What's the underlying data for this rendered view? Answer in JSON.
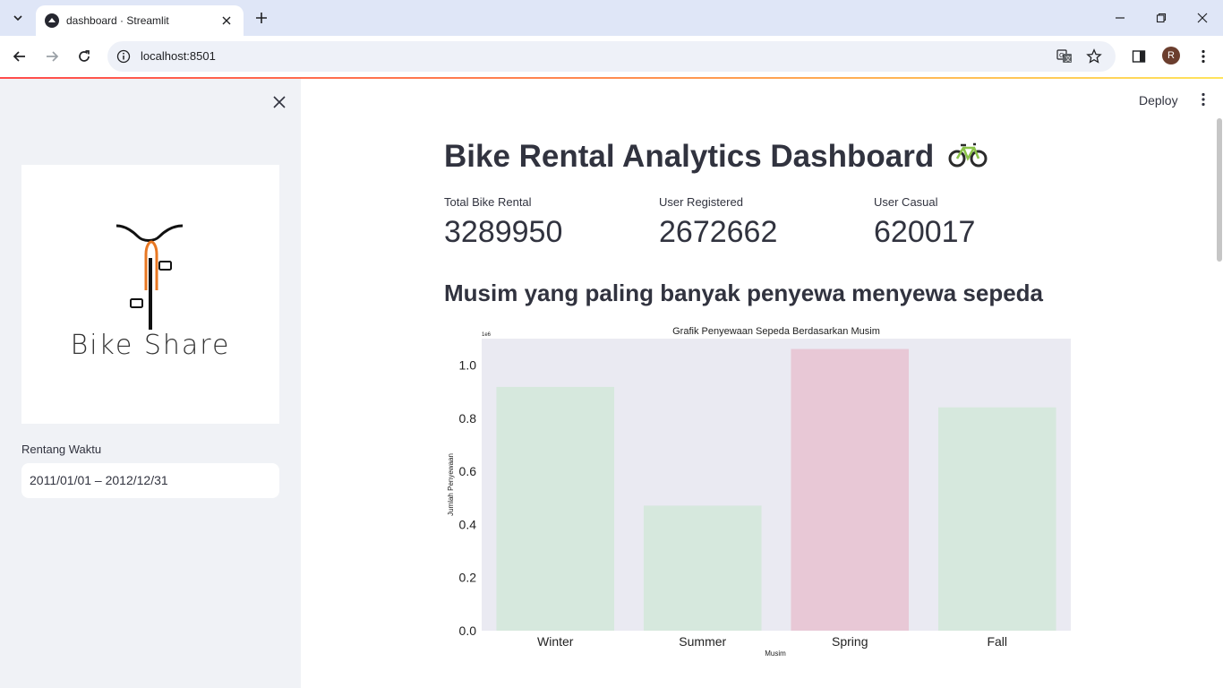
{
  "browser": {
    "tab_title": "dashboard · Streamlit",
    "url": "localhost:8501",
    "avatar_initial": "R"
  },
  "sidebar": {
    "logo_text": "Bike Share",
    "date_label": "Rentang Waktu",
    "date_value": "2011/01/01 – 2012/12/31"
  },
  "header": {
    "deploy_label": "Deploy"
  },
  "main": {
    "title": "Bike Rental Analytics Dashboard",
    "metrics": [
      {
        "label": "Total Bike Rental",
        "value": "3289950"
      },
      {
        "label": "User Registered",
        "value": "2672662"
      },
      {
        "label": "User Casual",
        "value": "620017"
      }
    ],
    "section_title": "Musim yang paling banyak penyewa menyewa sepeda"
  },
  "chart_data": {
    "type": "bar",
    "title": "Grafik Penyewaan Sepeda Berdasarkan Musim",
    "xlabel": "Musim",
    "ylabel": "Jumlah Penyewaan",
    "scale_label": "1e6",
    "categories": [
      "Winter",
      "Summer",
      "Spring",
      "Fall"
    ],
    "values": [
      0.918,
      0.471,
      1.061,
      0.841
    ],
    "ylim": [
      0,
      1.1
    ],
    "yticks": [
      "0.0",
      "0.2",
      "0.4",
      "0.6",
      "0.8",
      "1.0"
    ],
    "colors": [
      "#d6e8dd",
      "#d6e8dd",
      "#e8c8d6",
      "#d6e8dd"
    ],
    "plot_background": "#eaeaf2",
    "grid": false
  }
}
